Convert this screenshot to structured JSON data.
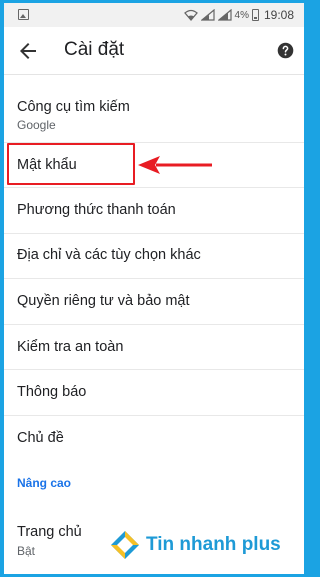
{
  "status_bar": {
    "battery_percent": "4%",
    "time": "19:08"
  },
  "app_bar": {
    "title": "Cài đặt",
    "back_icon": "arrow-back-icon",
    "help_icon": "help-icon"
  },
  "settings": {
    "search_engine": {
      "title": "Công cụ tìm kiếm",
      "subtitle": "Google"
    },
    "passwords": {
      "title": "Mật khẩu"
    },
    "payment_methods": {
      "title": "Phương thức thanh toán"
    },
    "addresses": {
      "title": "Địa chỉ và các tùy chọn khác"
    },
    "privacy": {
      "title": "Quyền riêng tư và bảo mật"
    },
    "safety_check": {
      "title": "Kiểm tra an toàn"
    },
    "notifications": {
      "title": "Thông báo"
    },
    "theme": {
      "title": "Chủ đề"
    },
    "advanced_header": "Nâng cao",
    "homepage": {
      "title": "Trang chủ",
      "subtitle": "Bật"
    }
  },
  "annotation": {
    "highlight_color": "#e81c23"
  },
  "watermark": {
    "brand": "Tin nhanh plus",
    "colors": {
      "blue": "#1e9ad6",
      "yellow": "#f6c026"
    }
  },
  "colors": {
    "frame_border": "#1ba3e3",
    "accent": "#1a73e8",
    "text_primary": "#202124",
    "text_secondary": "#5f6368"
  }
}
